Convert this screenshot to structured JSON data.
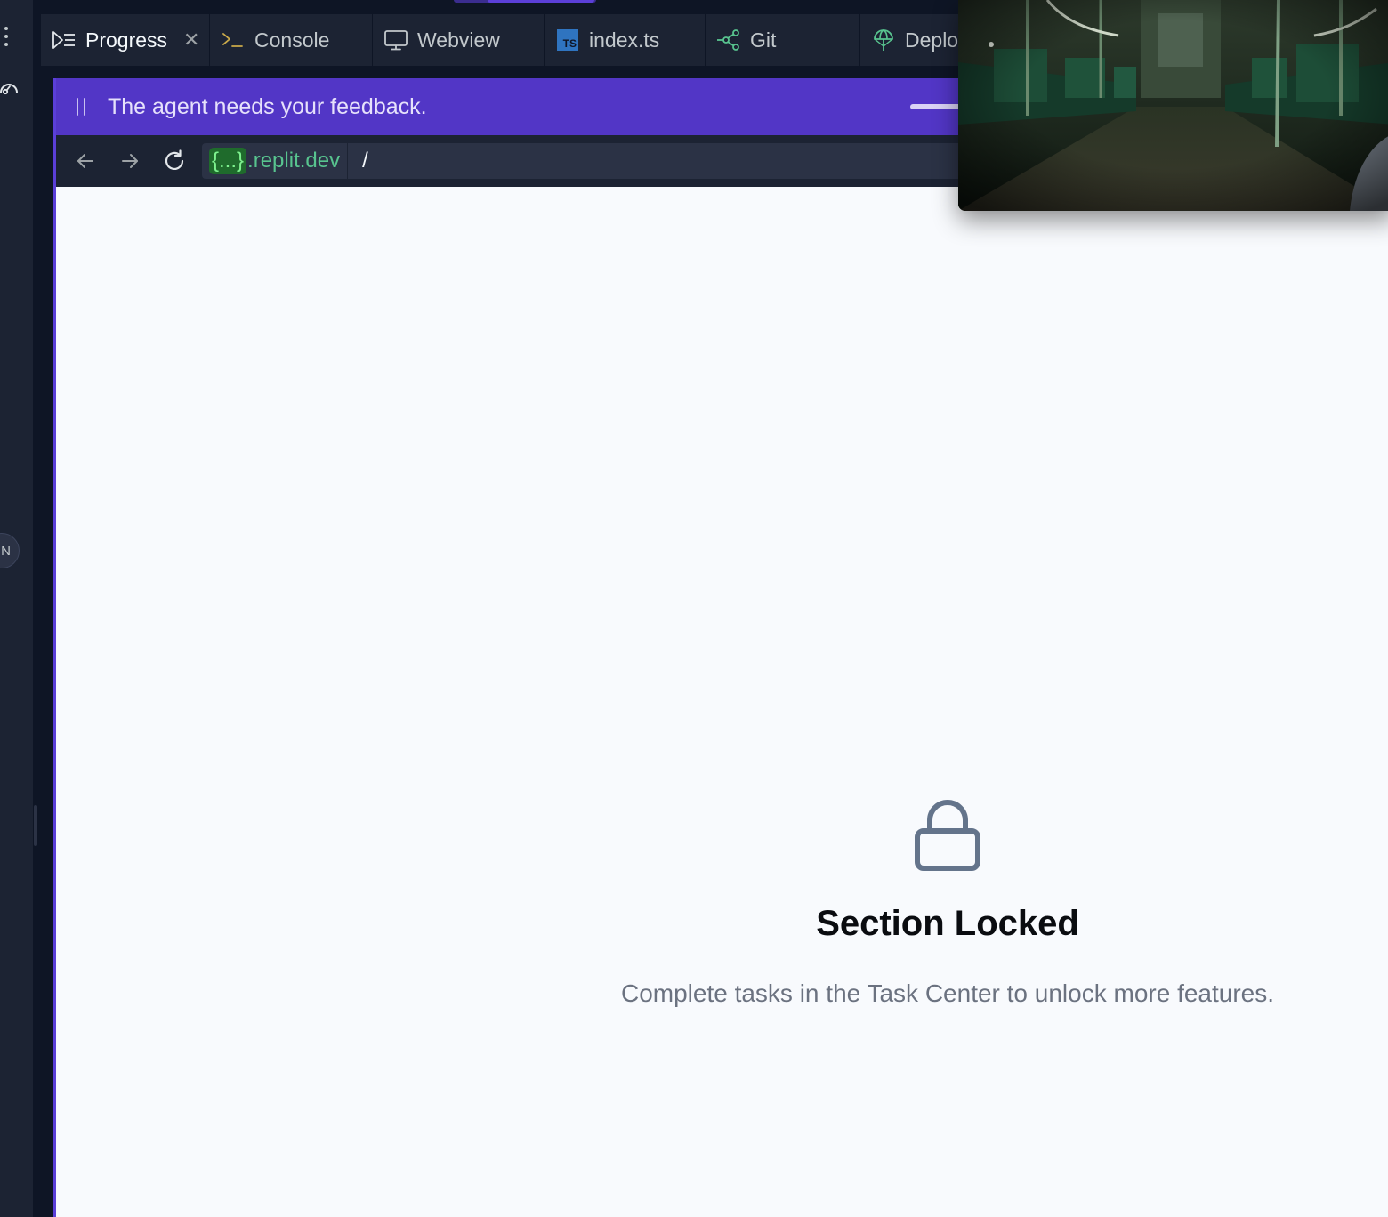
{
  "tabs": [
    {
      "label": "Progress",
      "icon": "progress-icon",
      "active": true,
      "closable": true
    },
    {
      "label": "Console",
      "icon": "terminal-icon",
      "active": false
    },
    {
      "label": "Webview",
      "icon": "monitor-icon",
      "active": false
    },
    {
      "label": "index.ts",
      "icon": "typescript-file-icon",
      "badge": "TS",
      "active": false
    },
    {
      "label": "Git",
      "icon": "git-icon",
      "active": false
    },
    {
      "label": "Deplo",
      "icon": "deploy-icon",
      "active": false
    }
  ],
  "rail": {
    "avatar_initial": "N"
  },
  "banner": {
    "message": "The agent needs your feedback."
  },
  "browser": {
    "url_token": "{...}",
    "url_host": ".replit.dev",
    "url_path": "/"
  },
  "locked": {
    "title": "Section Locked",
    "description": "Complete tasks in the Task Center to unlock more features."
  },
  "colors": {
    "accent": "#5236c6",
    "url_green": "#58c48f",
    "background": "#0e1525",
    "panel_bg": "#1c2333",
    "content_bg": "#f8fafd"
  }
}
